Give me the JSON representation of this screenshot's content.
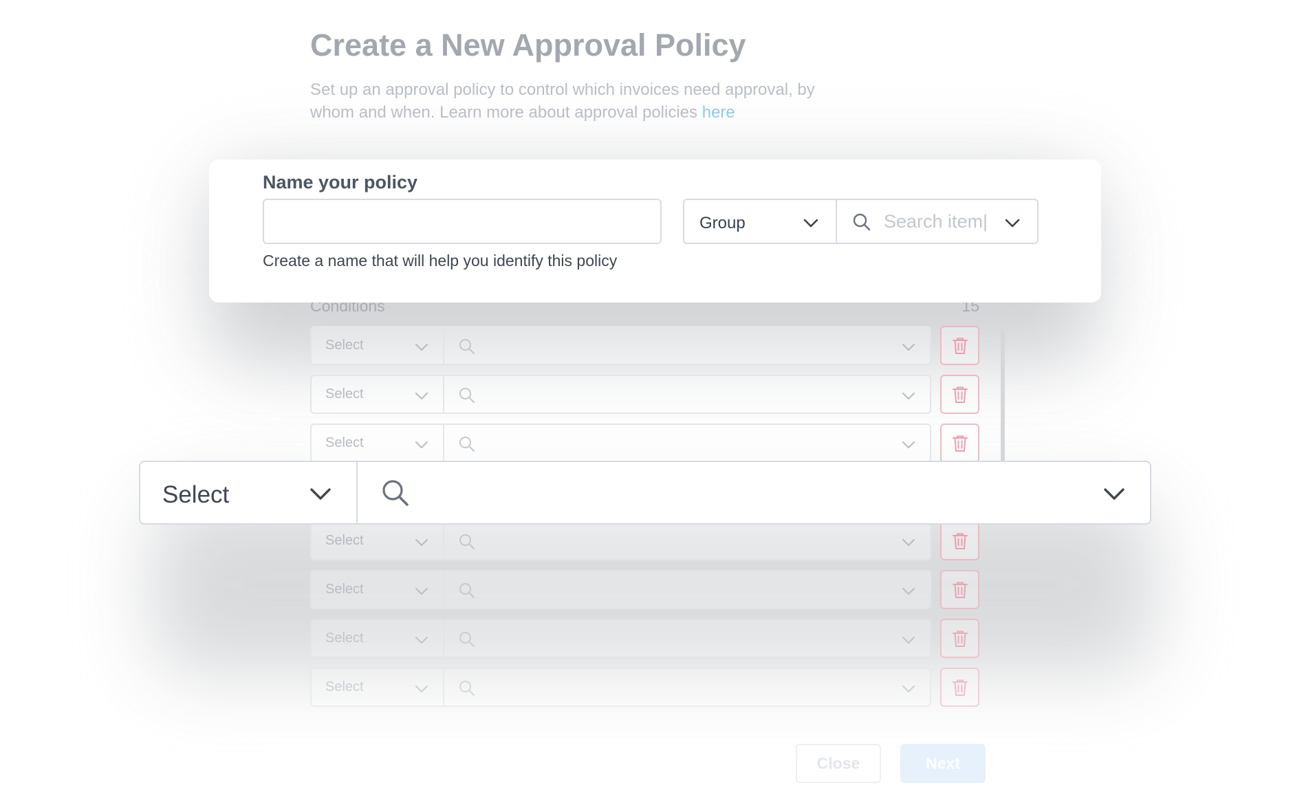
{
  "header": {
    "title": "Create a New Approval Policy",
    "description": "Set up an approval policy to control which invoices need approval, by whom and when. Learn more about approval policies",
    "link_text": "here"
  },
  "name_card": {
    "label": "Name your policy",
    "input_value": "",
    "helper_text": "Create a name that will help you identify this policy",
    "group_select": "Group",
    "search_placeholder": "Search item|"
  },
  "conditions": {
    "label": "Conditions",
    "count": "15",
    "rows": [
      {
        "select": "Select"
      },
      {
        "select": "Select"
      },
      {
        "select": "Select"
      },
      {
        "select": "Select"
      },
      {
        "select": "Select"
      },
      {
        "select": "Select"
      },
      {
        "select": "Select"
      }
    ]
  },
  "zoomed_row": {
    "select": "Select"
  },
  "footer": {
    "close_label": "Close",
    "next_label": "Next"
  },
  "colors": {
    "delete_accent": "#f1b7c0",
    "link": "#8fcbe6",
    "next_button": "#e6f1fb"
  },
  "icons": {
    "chevron": "chevron-down-icon",
    "search": "search-icon",
    "delete": "trash-icon"
  }
}
